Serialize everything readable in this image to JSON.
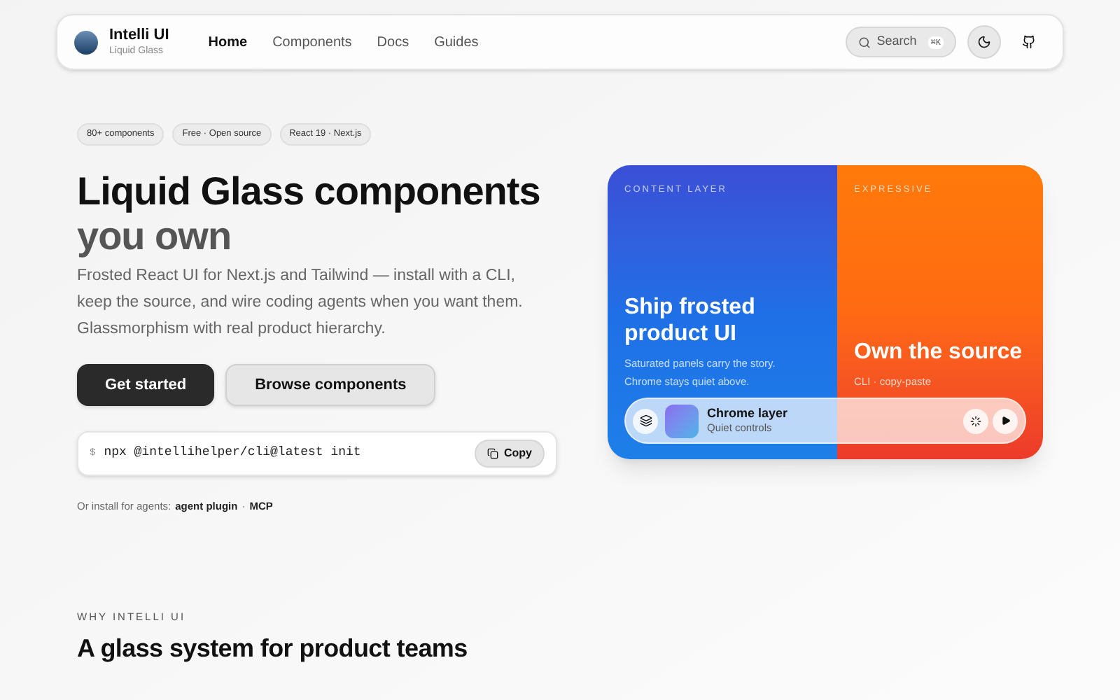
{
  "brand": {
    "name": "Intelli UI",
    "tagline": "Liquid Glass"
  },
  "nav": [
    {
      "label": "Home",
      "selected": true
    },
    {
      "label": "Components",
      "selected": false
    },
    {
      "label": "Docs",
      "selected": false
    },
    {
      "label": "Guides",
      "selected": false
    }
  ],
  "search": {
    "label": "Search",
    "shortcut": "⌘K"
  },
  "badges": [
    "80+ components",
    "Free · Open source",
    "React 19 · Next.js"
  ],
  "hero": {
    "title": "Liquid Glass components",
    "title_muted": "you own",
    "description": "Frosted React UI for Next.js and Tailwind — install with a CLI, keep the source, and wire coding agents when you want them. Glassmorphism with real product hierarchy."
  },
  "buttons": [
    {
      "label": "Get started",
      "kind": "primary"
    },
    {
      "label": "Browse components",
      "kind": "secondary"
    }
  ],
  "install": {
    "prompt": "$",
    "command": "npx @intellihelper/cli@latest init",
    "copy": "Copy"
  },
  "agents": {
    "intro": "Or install for agents:",
    "links": [
      "agent plugin",
      "MCP"
    ],
    "separator": "·"
  },
  "showcase": {
    "panels": [
      {
        "eyebrow": "CONTENT LAYER",
        "title": "Ship frosted product UI",
        "lines": [
          "Saturated panels carry the story.",
          "Chrome stays quiet above."
        ],
        "kind": "blue"
      },
      {
        "eyebrow": "EXPRESSIVE",
        "title": "Own the source",
        "lines": [
          "CLI · copy-paste"
        ],
        "kind": "orange"
      }
    ],
    "player": {
      "title": "Chrome layer",
      "subtitle": "Quiet controls"
    }
  },
  "section": {
    "eyebrow": "WHY INTELLI UI",
    "title": "A glass system for product teams"
  }
}
